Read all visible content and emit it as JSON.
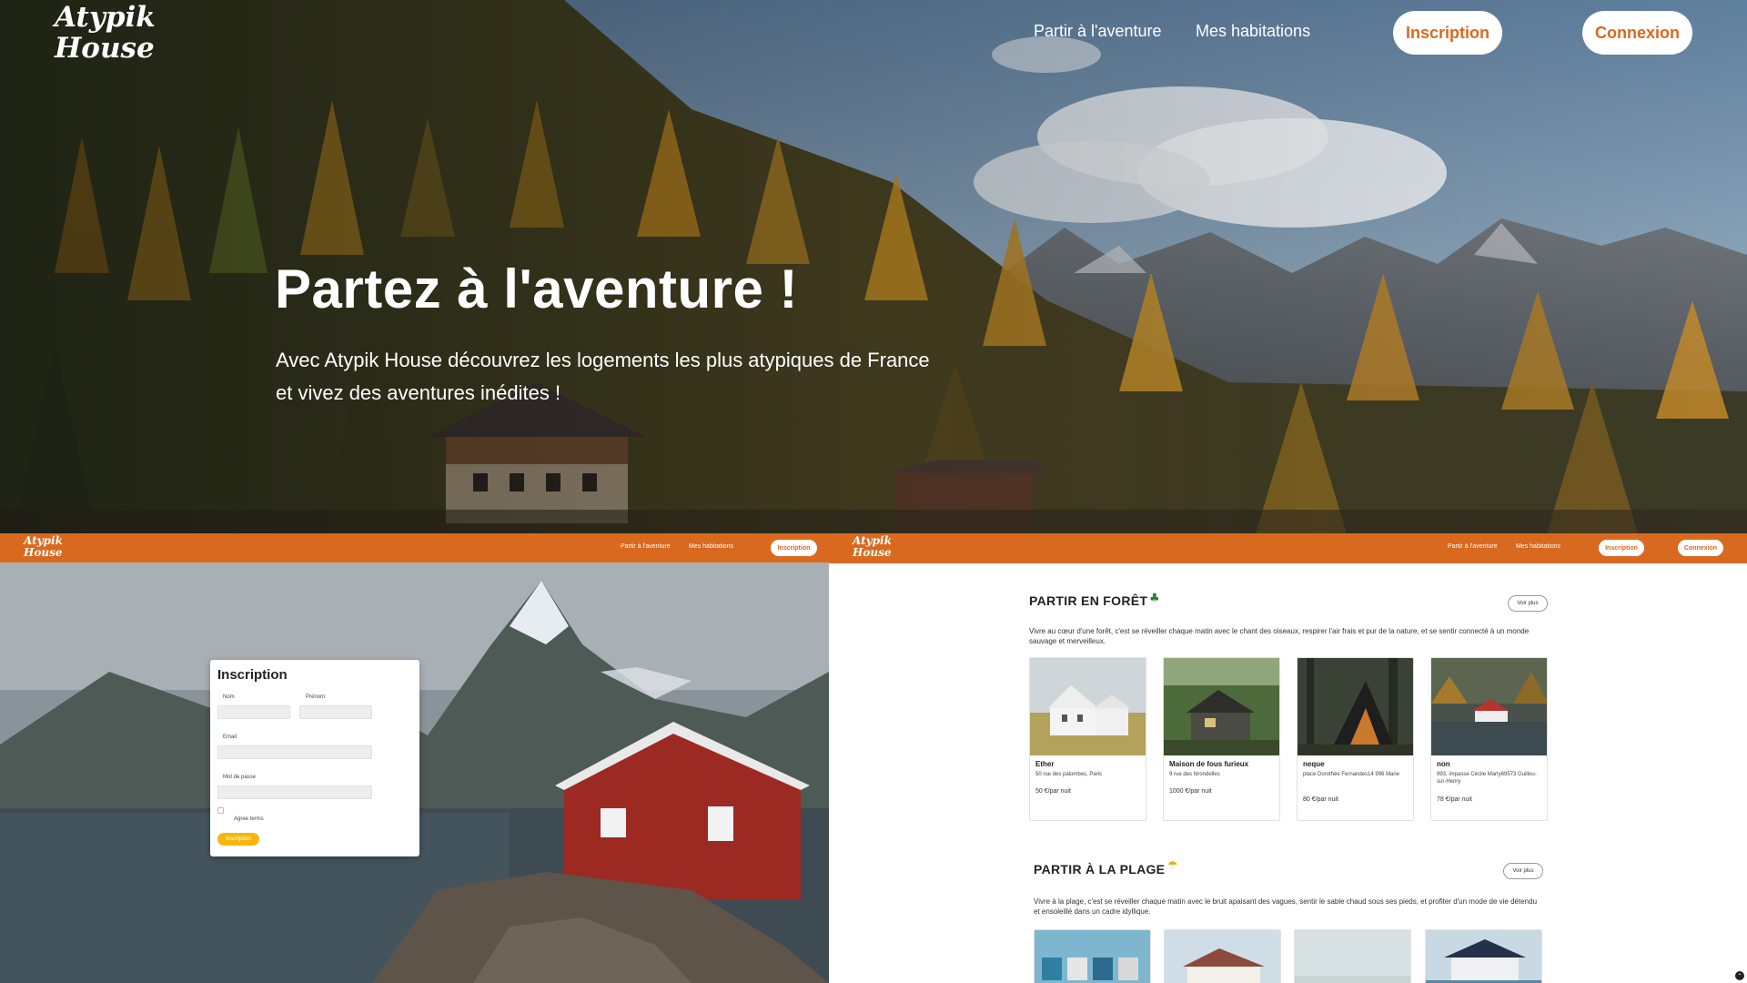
{
  "hero": {
    "logo_line1": "Atypik",
    "logo_line2": "House",
    "nav": {
      "link_adventure": "Partir à l'aventure",
      "link_homes": "Mes habitations",
      "btn_signup": "Inscription",
      "btn_login": "Connexion"
    },
    "title": "Partez à l'aventure !",
    "subtitle": "Avec Atypik House découvrez les logements les plus atypiques de France et vivez des aventures inédites !"
  },
  "left_panel": {
    "logo_line1": "Atypik",
    "logo_line2": "House",
    "nav": {
      "link_adventure": "Partir à l'aventure",
      "link_homes": "Mes habitations",
      "btn_signup": "Inscription"
    },
    "form": {
      "title": "Inscription",
      "label_nom": "Nom",
      "label_prenom": "Prénom",
      "label_email": "Email",
      "label_password": "Mot de passe",
      "label_terms": "Agree terms",
      "submit": "Inscription"
    }
  },
  "right_panel": {
    "logo_line1": "Atypik",
    "logo_line2": "House",
    "nav": {
      "link_adventure": "Partir à l'aventure",
      "link_homes": "Mes habitations",
      "btn_signup": "Inscription",
      "btn_login": "Connexion"
    },
    "forest": {
      "title": "PARTIR EN FORÊT",
      "icon": "tree-icon",
      "see_more": "Voir plus",
      "description": "Vivre au cœur d'une forêt, c'est se réveiller chaque matin avec le chant des oiseaux, respirer l'air frais et pur de la nature, et se sentir connecté à un monde sauvage et merveilleux.",
      "cards": [
        {
          "name": "Ether",
          "address": "50 rue des palombes, Paris",
          "price": "50 €/par nuit"
        },
        {
          "name": "Maison de fous furieux",
          "address": "9 rue des hirondelles",
          "price": "1000 €/par nuit"
        },
        {
          "name": "neque",
          "address": "place Dorothée Fernandes14 996 Marie",
          "price": "80 €/par nuit"
        },
        {
          "name": "non",
          "address": "993, impasse Cécile Marty69573 Guillou-sur-Henry",
          "price": "78 €/par nuit"
        }
      ]
    },
    "beach": {
      "title": "PARTIR À LA PLAGE",
      "icon": "umbrella-icon",
      "see_more": "Voir plus",
      "description": "Vivre à la plage, c'est se réveiller chaque matin avec le bruit apaisant des vagues, sentir le sable chaud sous ses pieds, et profiter d'un mode de vie détendu et ensoleillé dans un cadre idyllique."
    }
  },
  "colors": {
    "brand_orange": "#d9691f",
    "button_yellow": "#f5b70a"
  }
}
